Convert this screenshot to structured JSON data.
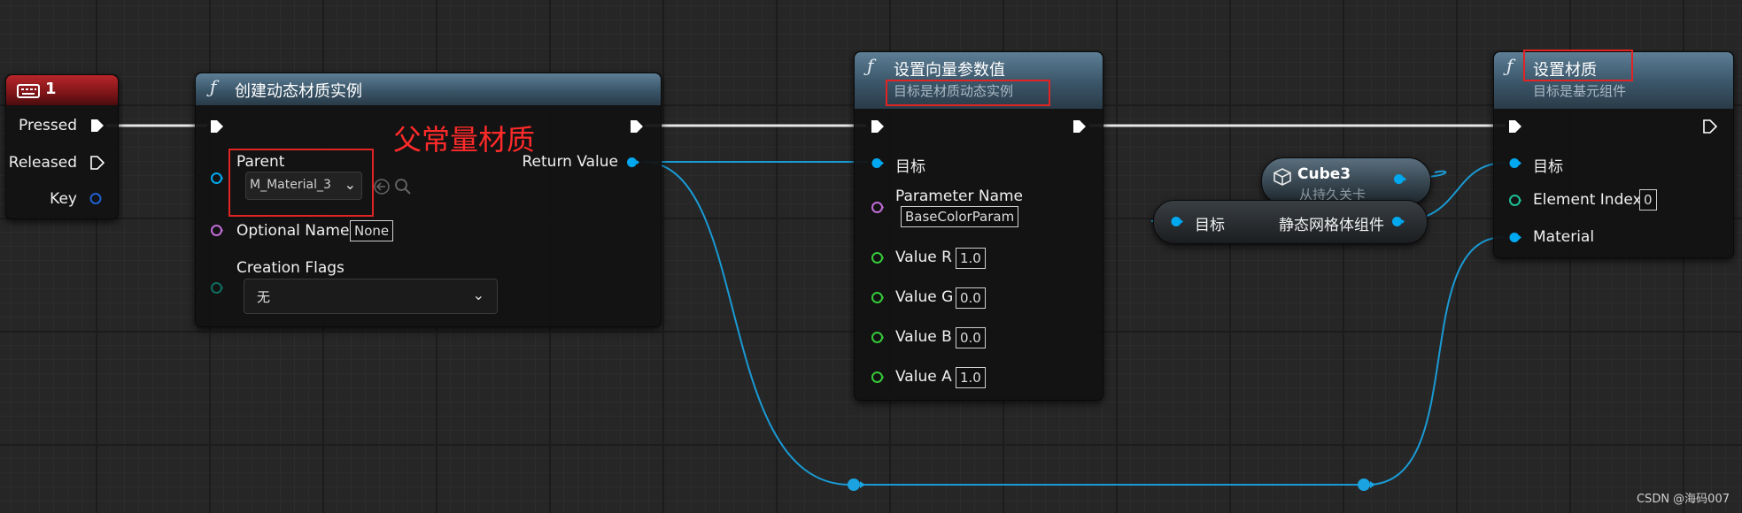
{
  "keyboard_event": {
    "title": "1",
    "pins": {
      "pressed": "Pressed",
      "released": "Released",
      "key": "Key"
    }
  },
  "create_dynamic_material": {
    "title": "创建动态材质实例",
    "parent_label": "Parent",
    "parent_value": "M_Material_3",
    "optional_name_label": "Optional Name",
    "optional_name_value": "None",
    "creation_flags_label": "Creation Flags",
    "creation_flags_value": "无",
    "return_value_label": "Return Value"
  },
  "annotation": "父常量材质",
  "set_vector_param": {
    "title": "设置向量参数值",
    "subtitle": "目标是材质动态实例",
    "target_label": "目标",
    "param_name_label": "Parameter Name",
    "param_name_value": "BaseColorParam",
    "values": [
      {
        "label": "Value R",
        "value": "1.0"
      },
      {
        "label": "Value G",
        "value": "0.0"
      },
      {
        "label": "Value B",
        "value": "0.0"
      },
      {
        "label": "Value A",
        "value": "1.0"
      }
    ]
  },
  "cube_var": {
    "title": "Cube3",
    "subtitle": "从持久关卡"
  },
  "mesh_getter": {
    "input_label": "目标",
    "output_label": "静态网格体组件"
  },
  "set_material": {
    "title": "设置材质",
    "subtitle": "目标是基元组件",
    "target_label": "目标",
    "element_index_label": "Element Index",
    "element_index_value": "0",
    "material_label": "Material"
  },
  "watermark": "CSDN @海码007",
  "colors": {
    "object_pin": "#00a8f0",
    "name_pin": "#c06cd8",
    "float_pin": "#35c93a",
    "enum_pin": "#0f6e60",
    "exec": "#ffffff",
    "wire_object": "#1a9ad4",
    "highlight": "#e02424",
    "event_header": "#a01f23",
    "function_header": "#4a6a80"
  },
  "icons": {
    "function": "function-f-icon",
    "keyboard": "keyboard-icon",
    "variable": "cube-variable-icon"
  }
}
